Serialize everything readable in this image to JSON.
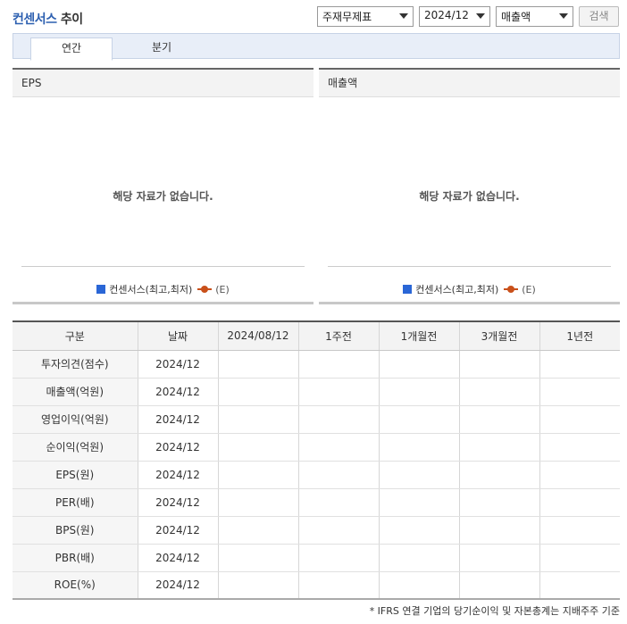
{
  "title": {
    "highlight": "컨센서스",
    "rest": " 추이"
  },
  "filters": {
    "type_select": "주재무제표",
    "period_select": "2024/12",
    "metric_select": "매출액",
    "search_button": "검색"
  },
  "tabs": [
    {
      "label": "연간",
      "active": true
    },
    {
      "label": "분기",
      "active": false
    }
  ],
  "panels": [
    {
      "title": "EPS",
      "empty_message": "해당 자료가 없습니다."
    },
    {
      "title": "매출액",
      "empty_message": "해당 자료가 없습니다."
    }
  ],
  "legend": {
    "range_label": "컨센서스(최고,최저)",
    "estimate_label": "(E)",
    "range_color": "#2a66d6",
    "estimate_color": "#c9501a"
  },
  "table": {
    "headers": [
      "구분",
      "날짜",
      "2024/08/12",
      "1주전",
      "1개월전",
      "3개월전",
      "1년전"
    ],
    "rows": [
      {
        "label": "투자의견(점수)",
        "date": "2024/12"
      },
      {
        "label": "매출액(억원)",
        "date": "2024/12"
      },
      {
        "label": "영업이익(억원)",
        "date": "2024/12"
      },
      {
        "label": "순이익(억원)",
        "date": "2024/12"
      },
      {
        "label": "EPS(원)",
        "date": "2024/12"
      },
      {
        "label": "PER(배)",
        "date": "2024/12"
      },
      {
        "label": "BPS(원)",
        "date": "2024/12"
      },
      {
        "label": "PBR(배)",
        "date": "2024/12"
      },
      {
        "label": "ROE(%)",
        "date": "2024/12"
      }
    ]
  },
  "footnote": "* IFRS 연결 기업의 당기순이익 및 자본총계는 지배주주 기준"
}
